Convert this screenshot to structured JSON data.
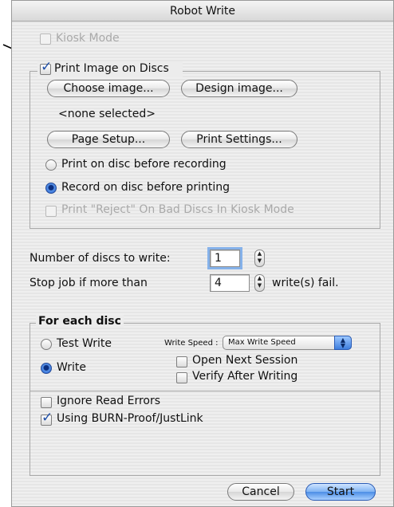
{
  "window": {
    "title": "Robot Write"
  },
  "kiosk": {
    "label": "Kiosk Mode",
    "checked": false,
    "enabled": false
  },
  "print_group": {
    "label": "Print Image on Discs",
    "checked": true,
    "choose_image_label": "Choose image...",
    "design_image_label": "Design image...",
    "selection_text": "<none selected>",
    "page_setup_label": "Page Setup...",
    "print_settings_label": "Print Settings...",
    "radio_before_recording": "Print on disc before recording",
    "radio_before_printing": "Record on disc before printing",
    "selected_radio": "Record on disc before printing",
    "reject_label": "Print \"Reject\" On Bad Discs In Kiosk Mode",
    "reject_checked": false
  },
  "discs": {
    "count_label": "Number of discs to write:",
    "count_value": "1",
    "stop_label": "Stop job if more than",
    "stop_value": "4",
    "stop_suffix": "write(s) fail."
  },
  "each_disc": {
    "legend": "For each disc",
    "test_write_label": "Test Write",
    "write_label": "Write",
    "selected": "Write",
    "speed_label": "Write Speed :",
    "speed_value": "Max Write Speed",
    "open_next_session_label": "Open Next Session",
    "open_next_session_checked": false,
    "verify_label": "Verify After Writing",
    "verify_checked": false
  },
  "options": {
    "ignore_read_errors_label": "Ignore Read Errors",
    "ignore_read_errors_checked": false,
    "burn_proof_label": "Using BURN-Proof/JustLink",
    "burn_proof_checked": true
  },
  "footer": {
    "cancel_label": "Cancel",
    "start_label": "Start"
  },
  "colors": {
    "accent": "#3e7ede",
    "border": "#a8a8a8"
  }
}
